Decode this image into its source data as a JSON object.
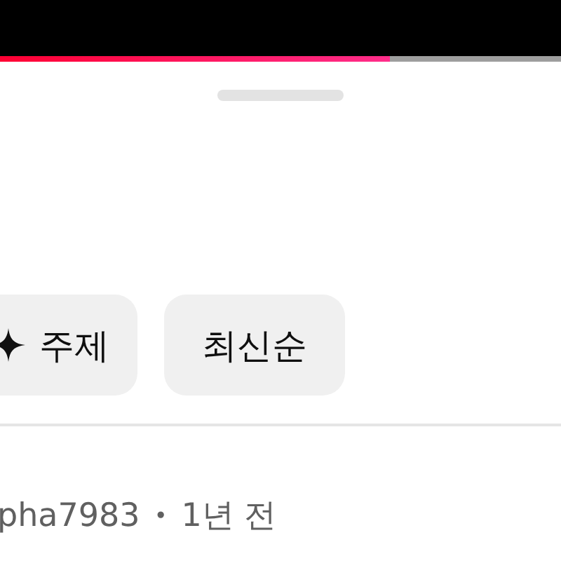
{
  "video": {
    "progress": {
      "level": 0.695
    }
  },
  "sheet": {
    "filters": [
      {
        "label": "주제",
        "kind": "topic"
      },
      {
        "label": "최신순",
        "kind": "plain"
      }
    ],
    "comment": {
      "author": "pha7983",
      "separator": "•",
      "time": "1년 전"
    }
  }
}
